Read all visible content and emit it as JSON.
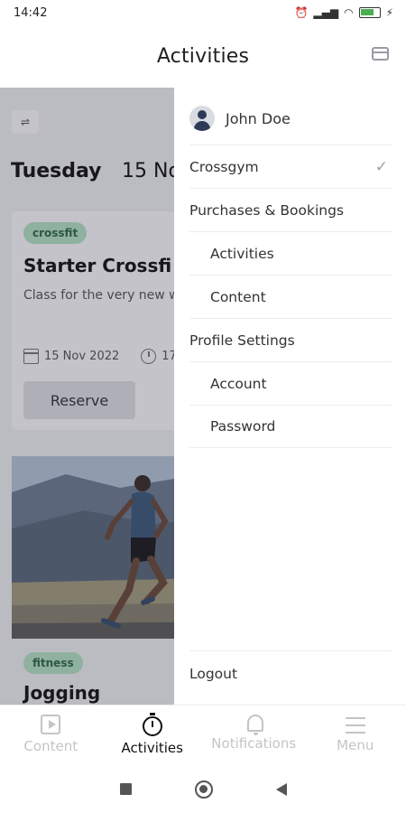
{
  "status": {
    "time": "14:42",
    "icons": [
      "alarm-icon",
      "signal-icon",
      "wifi-icon",
      "battery-icon",
      "charging-icon"
    ]
  },
  "header": {
    "title": "Activities",
    "action_icon": "card-icon"
  },
  "background": {
    "day": "Tuesday",
    "date": "15 No",
    "card1": {
      "tag": "crossfit",
      "title": "Starter Crossfi",
      "description": "Class for the very new want to workout at th",
      "date": "15 Nov 2022",
      "time": "17",
      "button": "Reserve"
    },
    "card2": {
      "tag": "fitness",
      "title": "Jogging"
    }
  },
  "drawer": {
    "user_name": "John Doe",
    "items": [
      {
        "label": "Crossgym",
        "checked": true
      },
      {
        "label": "Purchases & Bookings"
      },
      {
        "label": "Activities"
      },
      {
        "label": "Content"
      },
      {
        "label": "Profile Settings"
      },
      {
        "label": "Account"
      },
      {
        "label": "Password"
      }
    ],
    "logout": "Logout"
  },
  "bottom_nav": {
    "items": [
      {
        "label": "Content",
        "icon": "play-icon",
        "active": false
      },
      {
        "label": "Activities",
        "icon": "stopwatch-icon",
        "active": true
      },
      {
        "label": "Notifications",
        "icon": "bell-icon",
        "active": false
      },
      {
        "label": "Menu",
        "icon": "menu-icon",
        "active": false
      }
    ]
  },
  "colors": {
    "chip_bg": "#b8e6c6",
    "chip_text": "#2f6b45",
    "active_nav": "#111111",
    "inactive_nav": "#c4c4c8"
  }
}
